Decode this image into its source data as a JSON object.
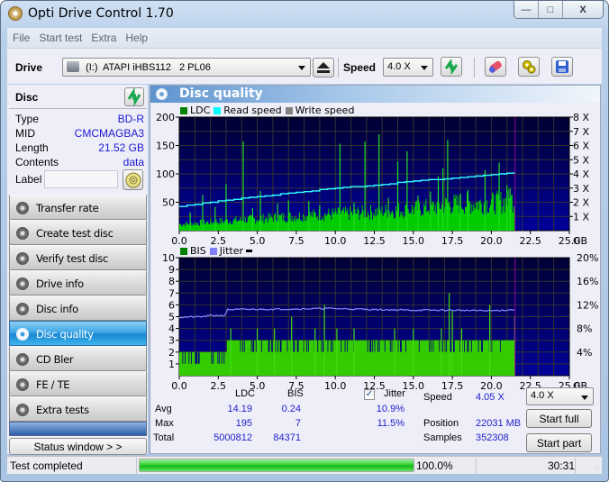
{
  "window": {
    "title": "Opti Drive Control 1.70",
    "caption_buttons": [
      "minimize",
      "maximize",
      "close"
    ]
  },
  "menu": [
    "File",
    "Start test",
    "Extra",
    "Help"
  ],
  "toolbar": {
    "drive_label": "Drive",
    "drive_value": "(I:)  ATAPI iHBS112   2 PL06",
    "speed_label": "Speed",
    "speed_value": "4.0 X",
    "icons": [
      "eject-icon",
      "refresh-icon",
      "erase-icon",
      "settings-icon",
      "save-icon"
    ]
  },
  "disc": {
    "title": "Disc",
    "rows": [
      {
        "key": "Type",
        "value": "BD-R"
      },
      {
        "key": "MID",
        "value": "CMCMAGBA3"
      },
      {
        "key": "Length",
        "value": "21.52 GB"
      },
      {
        "key": "Contents",
        "value": "data"
      }
    ],
    "label_key": "Label",
    "label_value": ""
  },
  "nav": [
    {
      "label": "Transfer rate",
      "active": false
    },
    {
      "label": "Create test disc",
      "active": false
    },
    {
      "label": "Verify test disc",
      "active": false
    },
    {
      "label": "Drive info",
      "active": false
    },
    {
      "label": "Disc info",
      "active": false
    },
    {
      "label": "Disc quality",
      "active": true
    },
    {
      "label": "CD Bler",
      "active": false
    },
    {
      "label": "FE / TE",
      "active": false
    },
    {
      "label": "Extra tests",
      "active": false
    }
  ],
  "status_window_button": "Status window > >",
  "panel": {
    "title": "Disc quality"
  },
  "colors": {
    "ldc": "#00cc00",
    "bis": "#33cc00",
    "read_speed": "#33ffff",
    "write_speed": "#888888",
    "jitter": "#8888ff",
    "plot_bg_top": "#000033",
    "plot_bg_bottom": "#000099",
    "end_marker": "#990099",
    "accent_blue": "#2222cc"
  },
  "chart_data": [
    {
      "type": "bar",
      "title": "LDC / Read speed",
      "legend": [
        {
          "name": "LDC",
          "color": "#008000"
        },
        {
          "name": "Read speed",
          "color": "#00ffff"
        },
        {
          "name": "Write speed",
          "color": "#808080"
        }
      ],
      "legend_position": "top-left",
      "xlabel": "GB",
      "x_ticks": [
        "0.0",
        "2.5",
        "5.0",
        "7.5",
        "10.0",
        "12.5",
        "15.0",
        "17.5",
        "20.0",
        "22.5",
        "25.0"
      ],
      "xlim": [
        0,
        25
      ],
      "y_left_ticks": [
        "50",
        "100",
        "150",
        "200"
      ],
      "ylim_left": [
        0,
        200
      ],
      "y_right_ticks": [
        "1 X",
        "2 X",
        "3 X",
        "4 X",
        "5 X",
        "6 X",
        "7 X",
        "8 X"
      ],
      "ylim_right": [
        0,
        8
      ],
      "grid": true,
      "data_end_gb": 21.52,
      "ldc_baseline": [
        [
          0.0,
          12
        ],
        [
          1.0,
          14
        ],
        [
          2.0,
          16
        ],
        [
          3.0,
          18
        ],
        [
          4.0,
          20
        ],
        [
          5.0,
          22
        ],
        [
          6.0,
          24
        ],
        [
          7.0,
          26
        ],
        [
          8.0,
          28
        ],
        [
          9.0,
          30
        ],
        [
          10.0,
          31
        ],
        [
          11.0,
          32
        ],
        [
          12.0,
          34
        ],
        [
          13.0,
          36
        ],
        [
          14.0,
          38
        ],
        [
          15.0,
          40
        ],
        [
          16.0,
          43
        ],
        [
          17.0,
          48
        ],
        [
          18.0,
          50
        ],
        [
          19.0,
          51
        ],
        [
          20.0,
          51
        ],
        [
          21.0,
          55
        ],
        [
          21.52,
          58
        ]
      ],
      "ldc_spikes": [
        [
          0.7,
          32
        ],
        [
          1.5,
          63
        ],
        [
          2.3,
          42
        ],
        [
          3.0,
          82
        ],
        [
          4.1,
          157
        ],
        [
          4.7,
          40
        ],
        [
          5.2,
          70
        ],
        [
          6.3,
          48
        ],
        [
          7.0,
          53
        ],
        [
          8.3,
          52
        ],
        [
          9.0,
          45
        ],
        [
          10.3,
          153
        ],
        [
          11.2,
          49
        ],
        [
          11.9,
          157
        ],
        [
          12.8,
          170
        ],
        [
          13.4,
          58
        ],
        [
          14.0,
          122
        ],
        [
          14.6,
          140
        ],
        [
          15.3,
          62
        ],
        [
          16.1,
          69
        ],
        [
          16.6,
          96
        ],
        [
          16.9,
          110
        ],
        [
          17.2,
          160
        ],
        [
          18.0,
          65
        ],
        [
          18.5,
          72
        ],
        [
          19.6,
          107
        ],
        [
          20.5,
          120
        ],
        [
          21.0,
          80
        ],
        [
          21.2,
          75
        ]
      ],
      "read_speed": [
        [
          0.0,
          1.7
        ],
        [
          2.5,
          2.1
        ],
        [
          5.0,
          2.4
        ],
        [
          7.5,
          2.7
        ],
        [
          10.0,
          3.0
        ],
        [
          12.5,
          3.2
        ],
        [
          15.0,
          3.5
        ],
        [
          17.5,
          3.7
        ],
        [
          20.0,
          3.95
        ],
        [
          21.52,
          4.1
        ]
      ]
    },
    {
      "type": "bar",
      "title": "BIS / Jitter",
      "legend": [
        {
          "name": "BIS",
          "color": "#008000"
        },
        {
          "name": "Jitter",
          "color": "#8080ff"
        }
      ],
      "legend_position": "top-left",
      "xlabel": "GB",
      "x_ticks": [
        "0.0",
        "2.5",
        "5.0",
        "7.5",
        "10.0",
        "12.5",
        "15.0",
        "17.5",
        "20.0",
        "22.5",
        "25.0"
      ],
      "xlim": [
        0,
        25
      ],
      "y_left_ticks": [
        "1",
        "2",
        "3",
        "4",
        "5",
        "6",
        "7",
        "8",
        "9",
        "10"
      ],
      "ylim_left": [
        0,
        10
      ],
      "y_right_ticks": [
        "4%",
        "8%",
        "12%",
        "16%",
        "20%"
      ],
      "ylim_right": [
        0,
        20
      ],
      "grid": true,
      "data_end_gb": 21.52,
      "bis_levels": [
        [
          0.0,
          2
        ],
        [
          3.0,
          3
        ],
        [
          21.52,
          3
        ]
      ],
      "bis_spikes": [
        [
          3.3,
          4
        ],
        [
          5.0,
          4
        ],
        [
          6.1,
          4
        ],
        [
          7.2,
          5
        ],
        [
          8.7,
          4
        ],
        [
          9.3,
          6
        ],
        [
          10.1,
          4
        ],
        [
          11.2,
          4
        ],
        [
          13.8,
          4
        ],
        [
          15.0,
          4
        ],
        [
          16.8,
          4
        ],
        [
          17.3,
          7
        ],
        [
          17.5,
          5.5
        ],
        [
          18.1,
          4
        ],
        [
          19.9,
          6
        ],
        [
          21.5,
          5
        ]
      ],
      "jitter": [
        [
          0.0,
          9.9
        ],
        [
          1.5,
          10.0
        ],
        [
          2.0,
          10.2
        ],
        [
          2.9,
          10.2
        ],
        [
          3.1,
          11.2
        ],
        [
          7.5,
          11.3
        ],
        [
          9.5,
          11.4
        ],
        [
          12.5,
          11.2
        ],
        [
          15.0,
          11.1
        ],
        [
          17.5,
          11.1
        ],
        [
          20.0,
          11.0
        ],
        [
          21.52,
          11.2
        ]
      ]
    }
  ],
  "stats": {
    "col_ldc": "LDC",
    "col_bis": "BIS",
    "jitter_label": "Jitter",
    "jitter_checked": true,
    "rows": [
      {
        "label": "Avg",
        "ldc": "14.19",
        "bis": "0.24",
        "jitter": "10.9%"
      },
      {
        "label": "Max",
        "ldc": "195",
        "bis": "7",
        "jitter": "11.5%"
      },
      {
        "label": "Total",
        "ldc": "5000812",
        "bis": "84371",
        "jitter": ""
      }
    ],
    "speed_label": "Speed",
    "speed_value": "4.05 X",
    "position_label": "Position",
    "position_value": "22031 MB",
    "samples_label": "Samples",
    "samples_value": "352308",
    "speed_select": "4.0 X",
    "start_full": "Start full",
    "start_part": "Start part"
  },
  "statusbar": {
    "text": "Test completed",
    "progress_percent": 100,
    "progress_label": "100.0%",
    "elapsed": "30:31"
  }
}
